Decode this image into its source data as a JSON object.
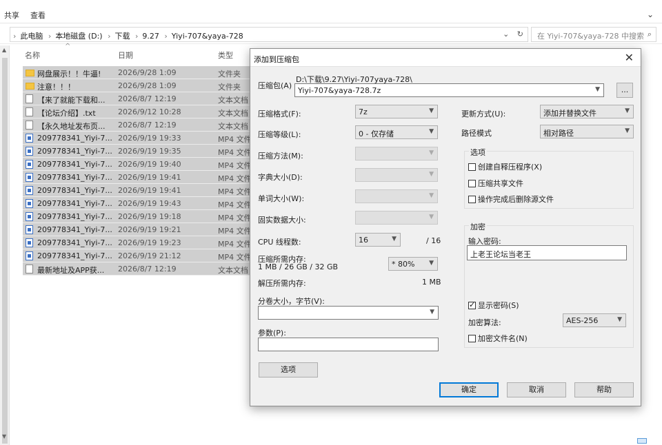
{
  "explorer": {
    "ribbon_tabs": [
      "共享",
      "查看"
    ],
    "breadcrumbs": [
      "此电脑",
      "本地磁盘 (D:)",
      "下载",
      "9.27",
      "Yiyi-707&yaya-728"
    ],
    "search_placeholder": "在 Yiyi-707&yaya-728 中搜索",
    "columns": {
      "name": "名称",
      "date": "日期",
      "type": "类型"
    },
    "files": [
      {
        "icon": "folder",
        "name": "网盘展示！！牛逼!",
        "date": "2026/9/28 1:09",
        "type": "文件夹"
      },
      {
        "icon": "folder",
        "name": "注意！！！",
        "date": "2026/9/28 1:09",
        "type": "文件夹"
      },
      {
        "icon": "txt",
        "name": "【来了就能下载和...",
        "date": "2026/8/7 12:19",
        "type": "文本文档"
      },
      {
        "icon": "txt",
        "name": "【论坛介绍】.txt",
        "date": "2026/9/12 10:28",
        "type": "文本文档"
      },
      {
        "icon": "txt",
        "name": "【永久地址发布页...",
        "date": "2026/8/7 12:19",
        "type": "文本文档"
      },
      {
        "icon": "mp4",
        "name": "209778341_Yiyi-7...",
        "date": "2026/9/19 19:33",
        "type": "MP4 文件"
      },
      {
        "icon": "mp4",
        "name": "209778341_Yiyi-7...",
        "date": "2026/9/19 19:35",
        "type": "MP4 文件"
      },
      {
        "icon": "mp4",
        "name": "209778341_Yiyi-7...",
        "date": "2026/9/19 19:40",
        "type": "MP4 文件"
      },
      {
        "icon": "mp4",
        "name": "209778341_Yiyi-7...",
        "date": "2026/9/19 19:41",
        "type": "MP4 文件"
      },
      {
        "icon": "mp4",
        "name": "209778341_Yiyi-7...",
        "date": "2026/9/19 19:41",
        "type": "MP4 文件"
      },
      {
        "icon": "mp4",
        "name": "209778341_Yiyi-7...",
        "date": "2026/9/19 19:43",
        "type": "MP4 文件"
      },
      {
        "icon": "mp4",
        "name": "209778341_Yiyi-7...",
        "date": "2026/9/19 19:18",
        "type": "MP4 文件"
      },
      {
        "icon": "mp4",
        "name": "209778341_Yiyi-7...",
        "date": "2026/9/19 19:21",
        "type": "MP4 文件"
      },
      {
        "icon": "mp4",
        "name": "209778341_Yiyi-7...",
        "date": "2026/9/19 19:23",
        "type": "MP4 文件"
      },
      {
        "icon": "mp4",
        "name": "209778341_Yiyi-7...",
        "date": "2026/9/19 21:12",
        "type": "MP4 文件"
      },
      {
        "icon": "txt",
        "name": "最新地址及APP获...",
        "date": "2026/8/7 12:19",
        "type": "文本文档"
      }
    ]
  },
  "dialog": {
    "title": "添加到压缩包",
    "archive_label": "压缩包(A)",
    "archive_path": "D:\\下载\\9.27\\Yiyi-707yaya-728\\",
    "archive_name": "Yiyi-707&yaya-728.7z",
    "browse_label": "...",
    "format_label": "压缩格式(F):",
    "format_value": "7z",
    "level_label": "压缩等级(L):",
    "level_value": "0 - 仅存储",
    "method_label": "压缩方法(M):",
    "dict_label": "字典大小(D):",
    "word_label": "单词大小(W):",
    "solid_label": "固实数据大小:",
    "threads_label": "CPU 线程数:",
    "threads_value": "16",
    "threads_total": "/ 16",
    "mem_comp_label": "压缩所需内存:",
    "mem_comp_value": "1 MB / 26 GB / 32 GB",
    "mem_comp_pct": "* 80%",
    "mem_decomp_label": "解压所需内存:",
    "mem_decomp_value": "1 MB",
    "split_label": "分卷大小，字节(V):",
    "split_value": "",
    "params_label": "参数(P):",
    "params_value": "",
    "options_button": "选项",
    "update_label": "更新方式(U):",
    "update_value": "添加并替换文件",
    "pathmode_label": "路径模式",
    "pathmode_value": "相对路径",
    "options_group": "选项",
    "opt_sfx": "创建自释压程序(X)",
    "opt_shared": "压缩共享文件",
    "opt_delete": "操作完成后删除源文件",
    "encrypt_group": "加密",
    "password_label": "输入密码:",
    "password_value": "上老王论坛当老王",
    "show_password": "显示密码(S)",
    "enc_method_label": "加密算法:",
    "enc_method_value": "AES-256",
    "enc_names": "加密文件名(N)",
    "ok": "确定",
    "cancel": "取消",
    "help": "帮助"
  }
}
